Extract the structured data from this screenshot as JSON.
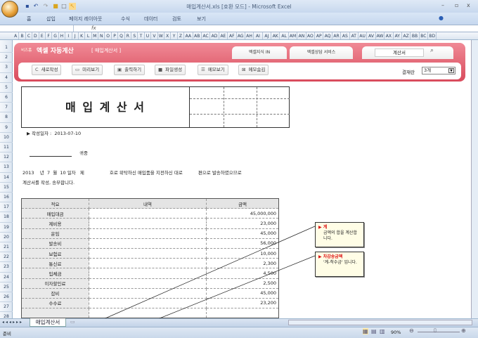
{
  "window": {
    "title": "매입계산서.xls [호환 모드] - Microsoft Excel"
  },
  "ribbon": {
    "tabs": [
      "홈",
      "삽입",
      "페이지 레이아웃",
      "수식",
      "데이터",
      "검토",
      "보기"
    ]
  },
  "formula": {
    "fx": "fx"
  },
  "columns": [
    "A",
    "B",
    "C",
    "D",
    "E",
    "F",
    "G",
    "H",
    "I",
    "J",
    "K",
    "L",
    "M",
    "N",
    "O",
    "P",
    "Q",
    "R",
    "S",
    "T",
    "U",
    "V",
    "W",
    "X",
    "Y",
    "Z",
    "AA",
    "AB",
    "AC",
    "AD",
    "AE",
    "AF",
    "AG",
    "AH",
    "AI",
    "AJ",
    "AK",
    "AL",
    "AM",
    "AN",
    "AO",
    "AP",
    "AQ",
    "AR",
    "AS",
    "AT",
    "AU",
    "AV",
    "AW",
    "AX",
    "AY",
    "AZ",
    "BB",
    "BC",
    "BD"
  ],
  "rows": [
    "1",
    "2",
    "3",
    "4",
    "5",
    "6",
    "7",
    "8",
    "9",
    "10",
    "11",
    "12",
    "13",
    "14",
    "15",
    "16",
    "17",
    "18",
    "19",
    "20",
    "21",
    "22",
    "23",
    "24",
    "25",
    "26",
    "27",
    "28"
  ],
  "banner": {
    "brand": "비즈폼",
    "title": "엑셀 자동계산",
    "subtitle": "[ 매입계산서 ]",
    "link1": "엑셀지식 IN",
    "link2": "엑셀상담 서비스",
    "search_value": "계산서",
    "buttons": [
      "새로작성",
      "미리보기",
      "출력하기",
      "파일생성",
      "메모보기",
      "메모숨김"
    ],
    "approval_label": "결재란",
    "approval_value": "3개"
  },
  "invoice": {
    "title": "매 입 계 산 서",
    "date_label": "▶ 작성일자 :",
    "date": "2013-07-10",
    "recipient_suffix": "귀중",
    "line1": [
      "2013",
      "년",
      "7",
      "월",
      "10",
      "일자",
      "제",
      "호로 위탁하신 매입품을 지전하신 대로",
      "편으로 발송하였으므로"
    ],
    "line2": "계산서를 작성, 송부합니다."
  },
  "table": {
    "headers": [
      "적요",
      "내역",
      "금액"
    ],
    "rows": [
      [
        "매입대금",
        "",
        "45,000,000"
      ],
      [
        "제비용",
        "",
        "23,000"
      ],
      [
        "운임",
        "",
        "45,000"
      ],
      [
        "발송비",
        "",
        "56,000"
      ],
      [
        "보험료",
        "",
        "10,000"
      ],
      [
        "통신료",
        "",
        "2,300"
      ],
      [
        "입체금",
        "",
        "4,500"
      ],
      [
        "이자할인료",
        "",
        "2,500"
      ],
      [
        "잡비",
        "",
        "45,000"
      ],
      [
        "수수료",
        "",
        "23,200"
      ],
      [
        "",
        "",
        ""
      ]
    ]
  },
  "comments": [
    {
      "title": "계",
      "text": "금액의 합을 계산합니다."
    },
    {
      "title": "차감송금액",
      "text": "'계-착수금' 입니다."
    }
  ],
  "sheet_tabs": [
    "매입계산서"
  ],
  "status": {
    "text": "준비",
    "zoom": "90%"
  }
}
